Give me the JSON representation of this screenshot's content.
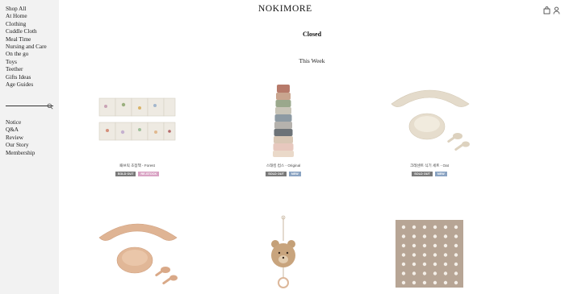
{
  "brand": {
    "logo": "NOKIMORE"
  },
  "sidebar": {
    "categories": [
      "Shop All",
      "At Home",
      "Clothing",
      "Cuddle Cloth",
      "Meal Time",
      "Nursing and Care",
      "On the go",
      "Toys",
      "Teether",
      "Gifts Ideas",
      "Age Guides"
    ],
    "search": {
      "placeholder": "",
      "icon": "search-icon"
    },
    "secondary": [
      "Notice",
      "Q&A",
      "Review",
      "Our Story",
      "Membership"
    ]
  },
  "header": {
    "icons": [
      "shopping-bag-icon",
      "user-icon"
    ]
  },
  "main": {
    "status": "Closed",
    "section_title": "This Week",
    "products": [
      {
        "name": "패브릭 초점책 - Forest",
        "badges": [
          "SOLD OUT",
          "RE-STOCK"
        ]
      },
      {
        "name": "스태킹 컵스 - Original",
        "badges": [
          "SOLD OUT",
          "NEW"
        ]
      },
      {
        "name": "크레센트 식기 세트 - Oat",
        "badges": [
          "SOLD OUT",
          "NEW"
        ]
      },
      {
        "name": "",
        "badges": []
      },
      {
        "name": "",
        "badges": []
      },
      {
        "name": "",
        "badges": []
      }
    ]
  },
  "colors": {
    "sidebar_bg": "#f2f2f2",
    "soldout": "#7a7a7a",
    "restock": "#d9a3c4",
    "new": "#8aa3c2"
  }
}
